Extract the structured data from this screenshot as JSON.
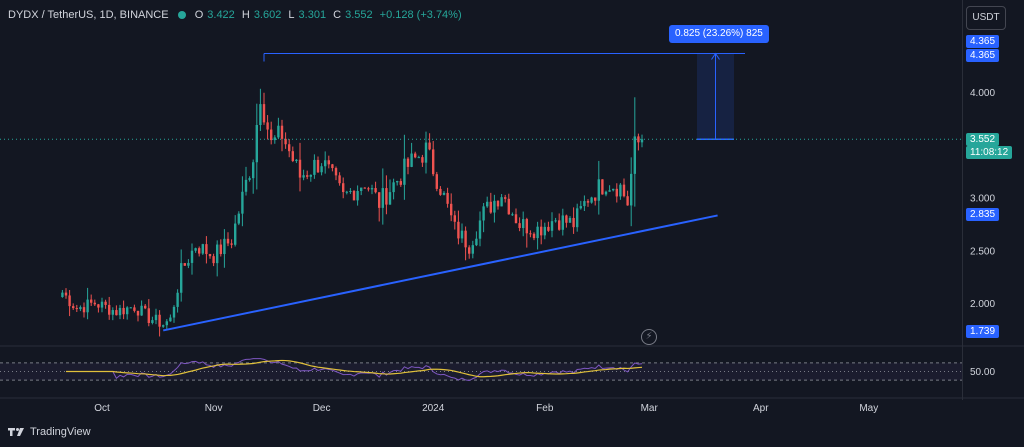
{
  "header": {
    "symbol": "DYDX / TetherUS, 1D, BINANCE",
    "o_label": "O",
    "o_value": "3.422",
    "h_label": "H",
    "h_value": "3.602",
    "l_label": "L",
    "l_value": "3.301",
    "c_label": "C",
    "c_value": "3.552",
    "change": "+0.128 (+3.74%)"
  },
  "currency_button": "USDT",
  "measure_label": "0.825 (23.26%) 825",
  "badges": {
    "top_price_a": "4.365",
    "top_price_b": "4.365",
    "last_price": "3.552",
    "countdown": "11:08:12",
    "trend_level": "2.835",
    "low_level": "1.739",
    "rsi_level": "50.00"
  },
  "colors": {
    "up": "#26a69a",
    "down": "#ef5350",
    "trendline": "#2962ff",
    "rsi": "#7e57c2",
    "rsi_ma": "#e0c03b",
    "background": "#131722"
  },
  "icons": {
    "alert": "lightning-icon",
    "logo": "tradingview-logo"
  },
  "branding": "TradingView",
  "chart_data": {
    "type": "candlestick",
    "symbol": "DYDX / TetherUS",
    "timeframe": "1D",
    "exchange": "BINANCE",
    "x_tick_labels": [
      "Oct",
      "Nov",
      "Dec",
      "2024",
      "Feb",
      "Mar",
      "Apr",
      "May"
    ],
    "y_tick_labels": [
      "4.000",
      "3.000",
      "2.500",
      "2.000"
    ],
    "y_range": [
      1.6,
      4.7
    ],
    "ohlc_anchors": [
      {
        "date": "2023-09-20",
        "close": 2.1
      },
      {
        "date": "2023-09-24",
        "close": 1.95
      },
      {
        "date": "2023-09-29",
        "close": 2.0
      },
      {
        "date": "2023-10-05",
        "close": 1.92
      },
      {
        "date": "2023-10-10",
        "close": 1.97
      },
      {
        "date": "2023-10-14",
        "close": 1.86
      },
      {
        "date": "2023-10-18",
        "close": 1.8
      },
      {
        "date": "2023-10-20",
        "close": 1.84
      },
      {
        "date": "2023-10-23",
        "close": 2.3
      },
      {
        "date": "2023-10-27",
        "close": 2.55
      },
      {
        "date": "2023-11-01",
        "close": 2.45
      },
      {
        "date": "2023-11-06",
        "close": 2.6
      },
      {
        "date": "2023-11-09",
        "close": 3.0
      },
      {
        "date": "2023-11-12",
        "close": 3.4
      },
      {
        "date": "2023-11-14",
        "close": 4.0
      },
      {
        "date": "2023-11-17",
        "close": 3.5
      },
      {
        "date": "2023-11-20",
        "close": 3.6
      },
      {
        "date": "2023-11-25",
        "close": 3.2
      },
      {
        "date": "2023-12-01",
        "close": 3.35
      },
      {
        "date": "2023-12-07",
        "close": 3.0
      },
      {
        "date": "2023-12-13",
        "close": 3.15
      },
      {
        "date": "2023-12-17",
        "close": 2.95
      },
      {
        "date": "2023-12-25",
        "close": 3.3
      },
      {
        "date": "2023-12-30",
        "close": 3.45
      },
      {
        "date": "2024-01-03",
        "close": 3.1
      },
      {
        "date": "2024-01-07",
        "close": 2.7
      },
      {
        "date": "2024-01-11",
        "close": 2.55
      },
      {
        "date": "2024-01-15",
        "close": 2.85
      },
      {
        "date": "2024-01-20",
        "close": 3.05
      },
      {
        "date": "2024-01-25",
        "close": 2.75
      },
      {
        "date": "2024-01-30",
        "close": 2.7
      },
      {
        "date": "2024-02-04",
        "close": 2.8
      },
      {
        "date": "2024-02-09",
        "close": 2.75
      },
      {
        "date": "2024-02-13",
        "close": 3.0
      },
      {
        "date": "2024-02-18",
        "close": 3.15
      },
      {
        "date": "2024-02-22",
        "close": 3.1
      },
      {
        "date": "2024-02-24",
        "close": 2.95
      },
      {
        "date": "2024-02-26",
        "close": 3.48
      },
      {
        "date": "2024-02-28",
        "close": 3.552
      }
    ],
    "recent_wick_high": 3.95,
    "period_high": 4.365,
    "trendline": [
      {
        "date": "2023-10-18",
        "price": 1.74
      },
      {
        "date": "2024-03-20",
        "price": 2.83
      }
    ],
    "measure": {
      "from": 3.552,
      "to": 4.365,
      "change": 0.825,
      "percent": 23.26
    },
    "rsi": {
      "level_upper": 70,
      "level_lower": 30,
      "mid_label": "50.00"
    },
    "legend": "none",
    "grid": false
  }
}
